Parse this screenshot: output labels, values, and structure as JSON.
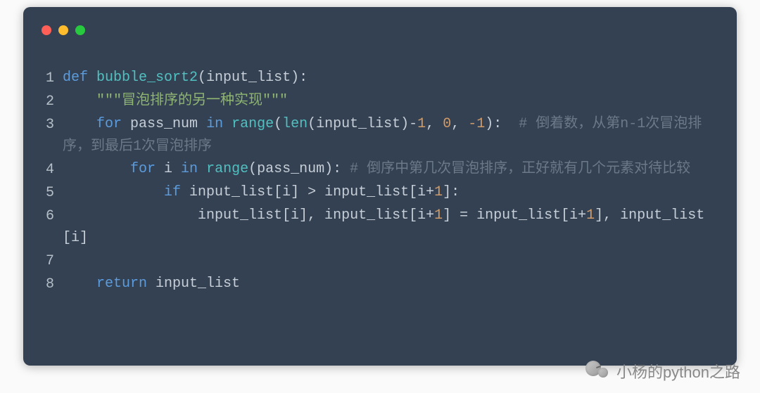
{
  "window": {
    "dot_colors": {
      "red": "#ff5f56",
      "yellow": "#ffbd2e",
      "green": "#27c93f"
    },
    "bg": "#344152"
  },
  "code": {
    "lines": [
      {
        "n": "1",
        "tokens": [
          {
            "cls": "kw",
            "t": "def "
          },
          {
            "cls": "fn",
            "t": "bubble_sort2"
          },
          {
            "cls": "txt",
            "t": "(input_list):"
          }
        ]
      },
      {
        "n": "2",
        "tokens": [
          {
            "cls": "txt",
            "t": "    "
          },
          {
            "cls": "str",
            "t": "\"\"\"冒泡排序的另一种实现\"\"\""
          }
        ]
      },
      {
        "n": "3",
        "tokens": [
          {
            "cls": "txt",
            "t": "    "
          },
          {
            "cls": "kw",
            "t": "for"
          },
          {
            "cls": "txt",
            "t": " pass_num "
          },
          {
            "cls": "kw",
            "t": "in"
          },
          {
            "cls": "txt",
            "t": " "
          },
          {
            "cls": "call",
            "t": "range"
          },
          {
            "cls": "txt",
            "t": "("
          },
          {
            "cls": "call",
            "t": "len"
          },
          {
            "cls": "txt",
            "t": "(input_list)-"
          },
          {
            "cls": "num",
            "t": "1"
          },
          {
            "cls": "txt",
            "t": ", "
          },
          {
            "cls": "num",
            "t": "0"
          },
          {
            "cls": "txt",
            "t": ", "
          },
          {
            "cls": "num",
            "t": "-1"
          },
          {
            "cls": "txt",
            "t": "):  "
          },
          {
            "cls": "cmt",
            "t": "# 倒着数，从第n-1次冒泡排序，到最后1次冒泡排序"
          }
        ]
      },
      {
        "n": "4",
        "tokens": [
          {
            "cls": "txt",
            "t": "        "
          },
          {
            "cls": "kw",
            "t": "for"
          },
          {
            "cls": "txt",
            "t": " i "
          },
          {
            "cls": "kw",
            "t": "in"
          },
          {
            "cls": "txt",
            "t": " "
          },
          {
            "cls": "call",
            "t": "range"
          },
          {
            "cls": "txt",
            "t": "(pass_num): "
          },
          {
            "cls": "cmt",
            "t": "# 倒序中第几次冒泡排序，正好就有几个元素对待比较"
          }
        ]
      },
      {
        "n": "5",
        "tokens": [
          {
            "cls": "txt",
            "t": "            "
          },
          {
            "cls": "kw",
            "t": "if"
          },
          {
            "cls": "txt",
            "t": " input_list[i] > input_list[i+"
          },
          {
            "cls": "num",
            "t": "1"
          },
          {
            "cls": "txt",
            "t": "]:"
          }
        ]
      },
      {
        "n": "6",
        "tokens": [
          {
            "cls": "txt",
            "t": "                input_list[i], input_list[i+"
          },
          {
            "cls": "num",
            "t": "1"
          },
          {
            "cls": "txt",
            "t": "] = input_list[i+"
          },
          {
            "cls": "num",
            "t": "1"
          },
          {
            "cls": "txt",
            "t": "], input_list[i]"
          }
        ]
      },
      {
        "n": "7",
        "tokens": [
          {
            "cls": "txt",
            "t": ""
          }
        ]
      },
      {
        "n": "8",
        "tokens": [
          {
            "cls": "txt",
            "t": "    "
          },
          {
            "cls": "kw",
            "t": "return"
          },
          {
            "cls": "txt",
            "t": " input_list"
          }
        ]
      }
    ]
  },
  "watermark": {
    "text": "小杨的python之路"
  }
}
